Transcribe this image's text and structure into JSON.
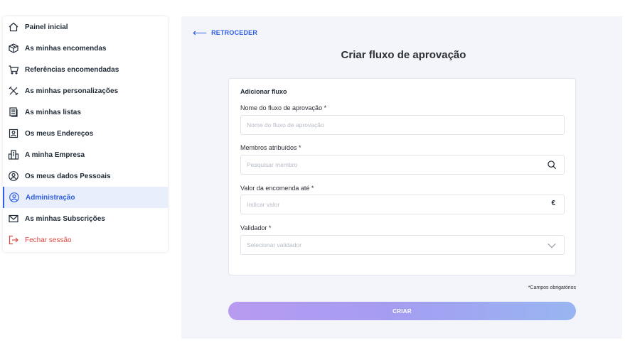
{
  "sidebar": {
    "items": [
      {
        "label": "Painel inicial",
        "icon": "home-icon"
      },
      {
        "label": "As minhas encomendas",
        "icon": "box-icon"
      },
      {
        "label": "Referências encomendadas",
        "icon": "cart-icon"
      },
      {
        "label": "As minhas personalizações",
        "icon": "tools-icon"
      },
      {
        "label": "As minhas listas",
        "icon": "list-icon"
      },
      {
        "label": "Os meus Endereços",
        "icon": "address-icon"
      },
      {
        "label": "A minha Empresa",
        "icon": "building-icon"
      },
      {
        "label": "Os meus dados Pessoais",
        "icon": "user-icon"
      },
      {
        "label": "Administração",
        "icon": "admin-icon",
        "active": true
      },
      {
        "label": "As minhas Subscrições",
        "icon": "mail-icon"
      },
      {
        "label": "Fechar sessão",
        "icon": "logout-icon"
      }
    ],
    "active_color": "#2f5fe0",
    "logout_color": "#e0463f"
  },
  "main": {
    "back_label": "RETROCEDER",
    "title": "Criar fluxo de aprovação",
    "form": {
      "section_title": "Adicionar fluxo",
      "fields": {
        "name": {
          "label": "Nome do fluxo de aprovação *",
          "placeholder": "Nome do fluxo de aprovação"
        },
        "members": {
          "label": "Membros atribuídos *",
          "placeholder": "Pesquisar membro",
          "icon": "search-icon"
        },
        "value": {
          "label": "Valor da encomenda até *",
          "placeholder": "Indicar valor",
          "suffix": "€"
        },
        "validator": {
          "label": "Validador *",
          "placeholder": "Selecionar validador",
          "icon": "chevron-down-icon"
        }
      }
    },
    "required_note": "*Campos obrigatórios",
    "submit_label": "CRIAR"
  }
}
